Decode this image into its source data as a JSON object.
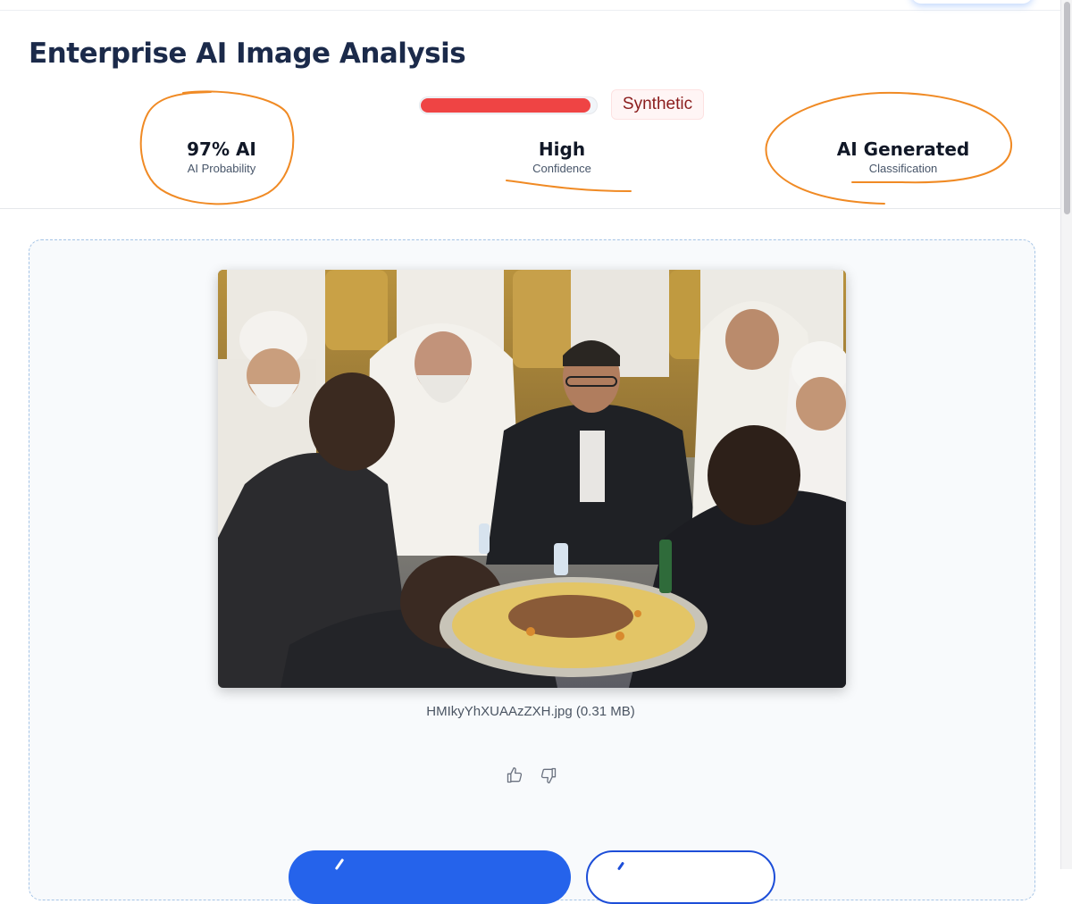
{
  "header": {
    "title": "Enterprise AI Image Analysis"
  },
  "result": {
    "score_fraction": 0.97,
    "badge": "Synthetic",
    "stats": [
      {
        "value": "97% AI",
        "label": "AI Probability"
      },
      {
        "value": "High",
        "label": "Confidence"
      },
      {
        "value": "AI Generated",
        "label": "Classification"
      }
    ]
  },
  "upload": {
    "filename": "HMIkyYhXUAAzZXH.jpg",
    "filesize": "(0.31 MB)"
  },
  "feedback": {
    "up_icon": "thumbs-up-icon",
    "down_icon": "thumbs-down-icon"
  },
  "colors": {
    "accent": "#2563eb",
    "danger": "#ef4444",
    "annotation": "#f08a24",
    "title": "#1b2a4a"
  }
}
